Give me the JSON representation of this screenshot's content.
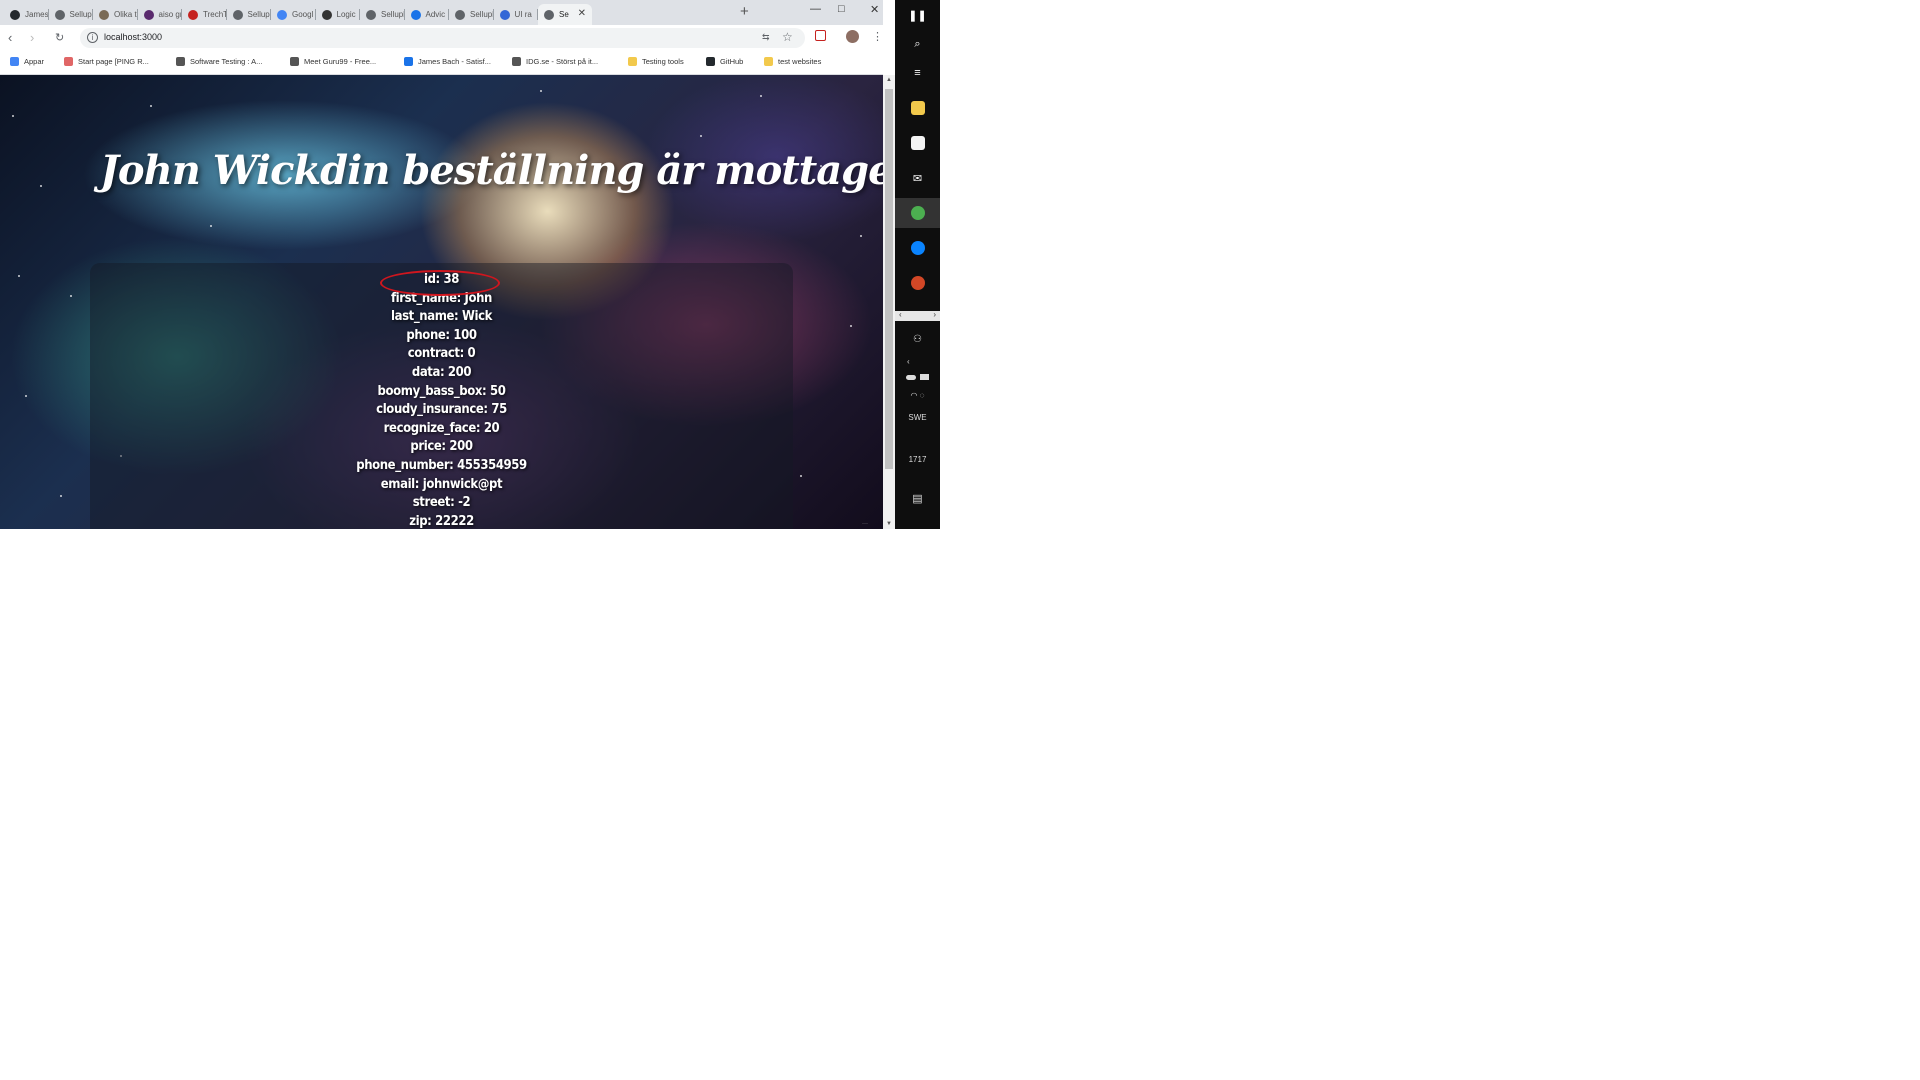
{
  "browser": {
    "tabs": [
      {
        "label": "Jamesh",
        "color": "#24292e"
      },
      {
        "label": "Sellupl",
        "color": "#5f6368"
      },
      {
        "label": "Olika t",
        "color": "#7a6a55"
      },
      {
        "label": "aiso gri",
        "color": "#5a2a6e"
      },
      {
        "label": "TrechTr",
        "color": "#c5221f"
      },
      {
        "label": "Sellupl",
        "color": "#5f6368"
      },
      {
        "label": "Googl",
        "color": "#4285f4"
      },
      {
        "label": "Logic",
        "color": "#333333"
      },
      {
        "label": "Sellupl",
        "color": "#5f6368"
      },
      {
        "label": "Advic",
        "color": "#1a73e8"
      },
      {
        "label": "Sellupl",
        "color": "#5f6368"
      },
      {
        "label": "UI ra",
        "color": "#3367d6"
      },
      {
        "label": "Se",
        "color": "#5f6368"
      }
    ],
    "new_tab": "+",
    "window_controls": {
      "minimize": "—",
      "maximize": "□",
      "close": "✕"
    },
    "tab_close": "✕",
    "nav": {
      "back": "‹",
      "forward": "›",
      "reload": "↻"
    },
    "url": "localhost:3000",
    "info_icon": "i",
    "toolbar_icons": [
      "translate-icon",
      "star-icon",
      "extension-icon",
      "profile-avatar",
      "menu-icon"
    ],
    "menu_glyph": "⋮",
    "bookmarks": [
      {
        "label": "Appar",
        "color": "#4285f4"
      },
      {
        "label": "Start page [PING R...",
        "color": "#e06666"
      },
      {
        "label": "Software Testing : A...",
        "color": "#555555"
      },
      {
        "label": "Meet Guru99 - Free...",
        "color": "#555555"
      },
      {
        "label": "James Bach - Satisf...",
        "color": "#1a73e8"
      },
      {
        "label": "IDG.se - Störst på it...",
        "color": "#555555"
      },
      {
        "label": "Testing tools",
        "color": "#f2c94c"
      },
      {
        "label": "GitHub",
        "color": "#24292e"
      },
      {
        "label": "test websites",
        "color": "#f2c94c"
      }
    ]
  },
  "page": {
    "title": "John Wickdin beställning är mottagen!",
    "order_fields": [
      "id: 38",
      "first_name: John",
      "last_name: Wick",
      "phone: 100",
      "contract: 0",
      "data: 200",
      "boomy_bass_box: 50",
      "cloudy_insurance: 75",
      "recognize_face: 20",
      "price: 200",
      "phone_number: 455354959",
      "email: johnwick@pt",
      "street: -2",
      "zip: 22222"
    ],
    "highlight_color": "#d0161e"
  },
  "scrollbar": {
    "up": "▲",
    "down": "▼"
  },
  "taskbar": {
    "items": [
      {
        "name": "start-icon",
        "glyph": "❚❚"
      },
      {
        "name": "search-icon",
        "glyph": "⌕"
      },
      {
        "name": "task-view-icon",
        "glyph": "≡"
      },
      {
        "name": "file-explorer-icon",
        "color": "#f2c94c"
      },
      {
        "name": "store-icon",
        "color": "#f4f4f4"
      },
      {
        "name": "mail-icon",
        "glyph": "✉"
      },
      {
        "name": "chrome-icon",
        "color": "#4caf50"
      },
      {
        "name": "edge-icon",
        "color": "#0a84ff"
      },
      {
        "name": "powerpoint-icon",
        "color": "#d24726"
      }
    ],
    "scroll_left": "‹",
    "scroll_right": "›",
    "tray": {
      "people_glyph": "⚇",
      "chevron": "‹",
      "language": "SWE",
      "time": "1717",
      "notifications_glyph": "▤"
    }
  }
}
